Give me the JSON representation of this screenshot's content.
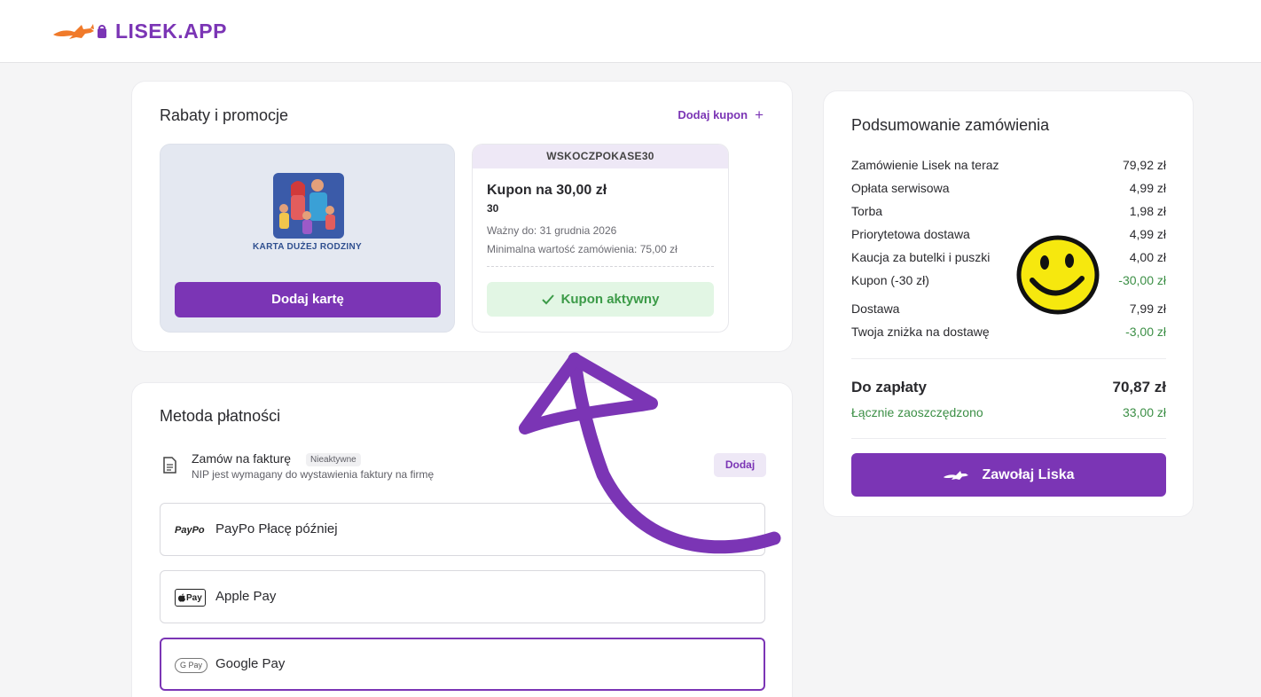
{
  "brand": {
    "name": "LISEK.APP",
    "accent": "#7b35b5"
  },
  "promo": {
    "title": "Rabaty i promocje",
    "add_coupon": "Dodaj kupon",
    "add_coupon_icon": "plus-icon",
    "family_card": {
      "label": "KARTA DUŻEJ RODZINY",
      "button": "Dodaj kartę"
    },
    "coupon": {
      "code": "WSKOCZPOKASE30",
      "title": "Kupon na 30,00 zł",
      "number": "30",
      "valid": "Ważny do: 31 grudnia 2026",
      "minimum": "Minimalna wartość zamówienia: 75,00 zł",
      "status": "Kupon aktywny",
      "status_icon": "check-icon"
    }
  },
  "payment": {
    "title": "Metoda płatności",
    "invoice": {
      "title": "Zamów na fakturę",
      "badge": "Nieaktywne",
      "subtitle": "NIP jest wymagany do wystawienia faktury na firmę",
      "button": "Dodaj",
      "icon": "document-icon"
    },
    "options": [
      {
        "logo": "PayPo",
        "label": "PayPo Płacę później",
        "selected": false
      },
      {
        "logo": "Pay",
        "label": "Apple Pay",
        "selected": false
      },
      {
        "logo": "G Pay",
        "label": "Google Pay",
        "selected": true
      }
    ]
  },
  "summary": {
    "title": "Podsumowanie zamówienia",
    "rows": [
      {
        "label": "Zamówienie Lisek na teraz",
        "value": "79,92 zł"
      },
      {
        "label": "Opłata serwisowa",
        "value": "4,99 zł"
      },
      {
        "label": "Torba",
        "value": "1,98 zł"
      },
      {
        "label": "Priorytetowa dostawa",
        "value": "4,99 zł"
      },
      {
        "label": "Kaucja za butelki i puszki",
        "value": "4,00 zł"
      },
      {
        "label": "Kupon (-30 zł)",
        "value": "-30,00 zł"
      },
      {
        "label": "Dostawa",
        "value": "7,99 zł"
      },
      {
        "label": "Twoja zniżka na dostawę",
        "value": "-3,00 zł"
      }
    ],
    "total_label": "Do zapłaty",
    "total_value": "70,87 zł",
    "saved_label": "Łącznie zaoszczędzono",
    "saved_value": "33,00 zł",
    "cta": "Zawołaj Liska"
  }
}
